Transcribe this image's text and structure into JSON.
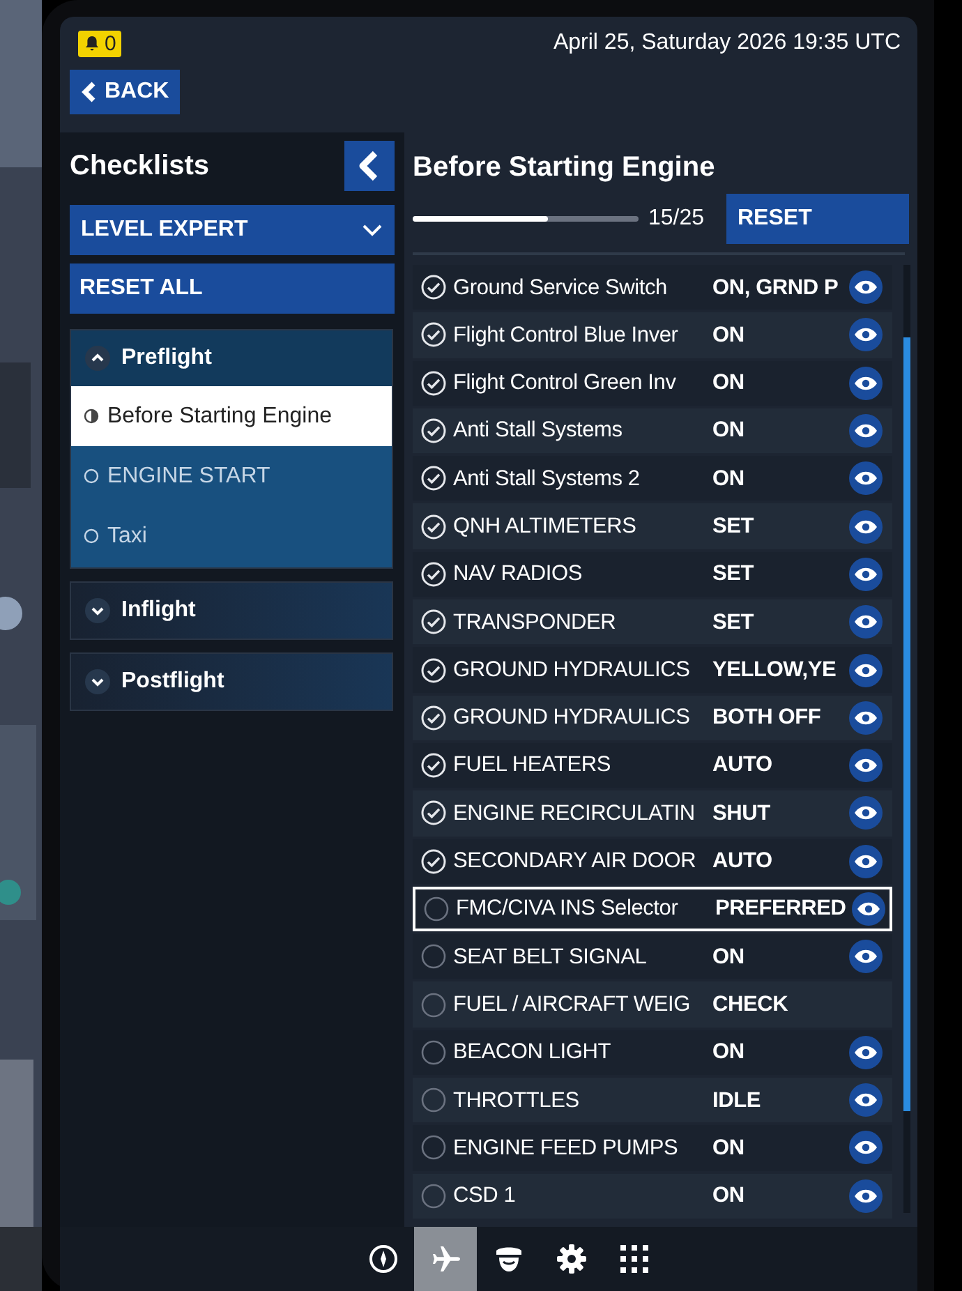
{
  "status_bar": {
    "notification_count": "0",
    "datetime": "April 25, Saturday 2026 19:35 UTC"
  },
  "back_button": "BACK",
  "sidebar": {
    "title": "Checklists",
    "level_dropdown": "LEVEL EXPERT",
    "reset_all": "RESET ALL",
    "groups": [
      {
        "label": "Preflight",
        "expanded": true,
        "children": [
          {
            "label": "Before Starting Engine",
            "kind": "partial",
            "selected": true
          },
          {
            "label": "ENGINE START",
            "kind": "empty",
            "selected": false
          },
          {
            "label": "Taxi",
            "kind": "empty",
            "selected": false
          }
        ]
      },
      {
        "label": "Inflight",
        "expanded": false
      },
      {
        "label": "Postflight",
        "expanded": false
      }
    ]
  },
  "checklist": {
    "title": "Before Starting Engine",
    "level": 0.6,
    "progress": "15/25",
    "reset": "RESET",
    "items": [
      {
        "label": "Ground Service Switch",
        "value": "ON, GRND P",
        "checked": true,
        "selected": false,
        "eye": true
      },
      {
        "label": "Flight Control Blue Inver",
        "value": "ON",
        "checked": true,
        "selected": false,
        "eye": true
      },
      {
        "label": "Flight Control Green Inv",
        "value": "ON",
        "checked": true,
        "selected": false,
        "eye": true
      },
      {
        "label": "Anti Stall Systems",
        "value": "ON",
        "checked": true,
        "selected": false,
        "eye": true
      },
      {
        "label": "Anti Stall Systems 2",
        "value": "ON",
        "checked": true,
        "selected": false,
        "eye": true
      },
      {
        "label": "QNH ALTIMETERS",
        "value": "SET",
        "checked": true,
        "selected": false,
        "eye": true
      },
      {
        "label": "NAV RADIOS",
        "value": "SET",
        "checked": true,
        "selected": false,
        "eye": true
      },
      {
        "label": "TRANSPONDER",
        "value": "SET",
        "checked": true,
        "selected": false,
        "eye": true
      },
      {
        "label": "GROUND HYDRAULICS",
        "value": "YELLOW,YE",
        "checked": true,
        "selected": false,
        "eye": true
      },
      {
        "label": "GROUND HYDRAULICS",
        "value": "BOTH OFF",
        "checked": true,
        "selected": false,
        "eye": true
      },
      {
        "label": "FUEL HEATERS",
        "value": "AUTO",
        "checked": true,
        "selected": false,
        "eye": true
      },
      {
        "label": "ENGINE RECIRCULATIN",
        "value": "SHUT",
        "checked": true,
        "selected": false,
        "eye": true
      },
      {
        "label": "SECONDARY AIR DOOR",
        "value": "AUTO",
        "checked": true,
        "selected": false,
        "eye": true
      },
      {
        "label": "FMC/CIVA INS Selector",
        "value": "PREFERRED",
        "checked": false,
        "selected": true,
        "eye": true
      },
      {
        "label": "SEAT BELT SIGNAL",
        "value": "ON",
        "checked": false,
        "selected": false,
        "eye": true
      },
      {
        "label": "FUEL / AIRCRAFT WEIG",
        "value": "CHECK",
        "checked": false,
        "selected": false,
        "eye": false
      },
      {
        "label": "BEACON LIGHT",
        "value": "ON",
        "checked": false,
        "selected": false,
        "eye": true
      },
      {
        "label": "THROTTLES",
        "value": "IDLE",
        "checked": false,
        "selected": false,
        "eye": true
      },
      {
        "label": "ENGINE FEED PUMPS",
        "value": "ON",
        "checked": false,
        "selected": false,
        "eye": true
      },
      {
        "label": "CSD 1",
        "value": "ON",
        "checked": false,
        "selected": false,
        "eye": true
      }
    ]
  },
  "bottom_nav": [
    {
      "kind": "compass",
      "selected": false
    },
    {
      "kind": "plane",
      "selected": true
    },
    {
      "kind": "pilot",
      "selected": false
    },
    {
      "kind": "gear",
      "selected": false
    },
    {
      "kind": "grid",
      "selected": false
    }
  ]
}
